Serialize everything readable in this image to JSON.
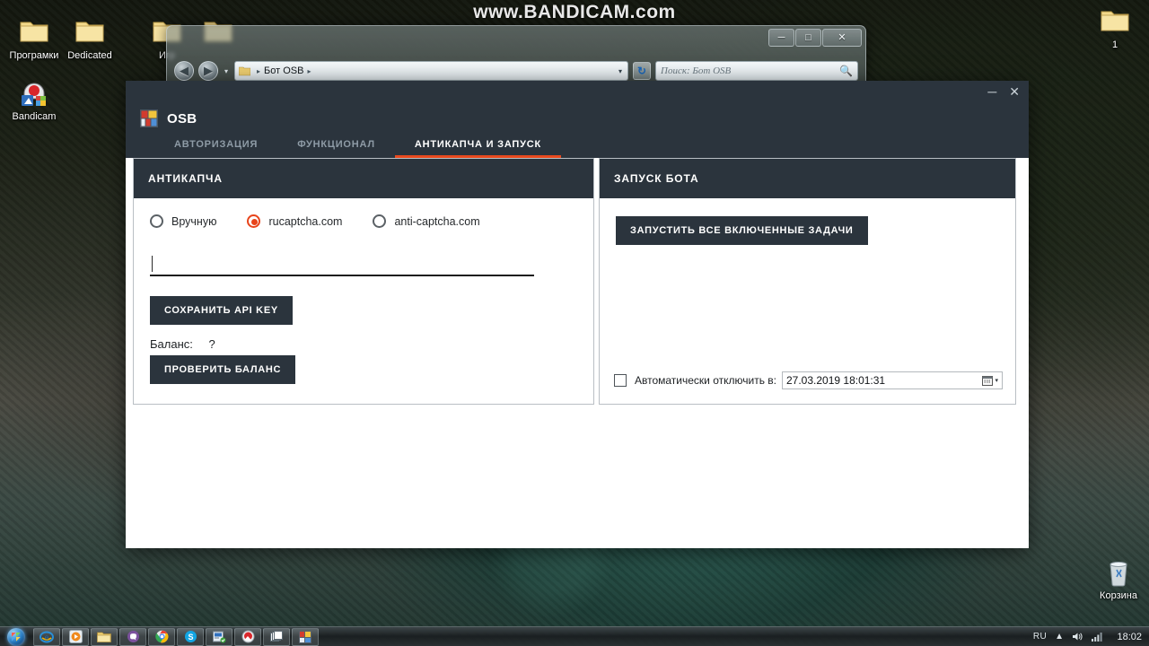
{
  "watermark": {
    "text": "www.BANDICAM.com"
  },
  "desktop": {
    "icons": [
      {
        "name": "folder-programki",
        "label": "Програмки",
        "icon": "folder-icon"
      },
      {
        "name": "folder-dedicated",
        "label": "Dedicated",
        "icon": "folder-icon"
      },
      {
        "name": "folder-igri",
        "label": "Игр",
        "icon": "folder-icon"
      },
      {
        "name": "folder-unnamed",
        "label": "",
        "icon": "folder-icon"
      },
      {
        "name": "folder-one",
        "label": "1",
        "icon": "folder-icon"
      },
      {
        "name": "shortcut-bandicam",
        "label": "Bandicam",
        "icon": "bandicam-icon"
      },
      {
        "name": "recycle-bin",
        "label": "Корзина",
        "icon": "recycle-bin-icon"
      }
    ]
  },
  "explorer": {
    "back_icon": "back-arrow-icon",
    "forward_icon": "forward-arrow-icon",
    "history_caret": "▾",
    "address": {
      "path": "Бот OSB",
      "sep": "▸",
      "caret": "▾"
    },
    "refresh_label": "↻",
    "search": {
      "placeholder": "Поиск: Бот OSB",
      "icon": "search-icon"
    },
    "window_buttons": {
      "minimize": "─",
      "maximize": "□",
      "close": "✕"
    }
  },
  "osb": {
    "title": "OSB",
    "logo_icon": "osb-logo-icon",
    "window_buttons": {
      "minimize": "─",
      "close": "✕"
    },
    "accent_color": "#e8491e",
    "header_color": "#2b343d",
    "tabs": [
      {
        "id": "tab-authorization",
        "label": "АВТОРИЗАЦИЯ",
        "active": false
      },
      {
        "id": "tab-functional",
        "label": "ФУНКЦИОНАЛ",
        "active": false
      },
      {
        "id": "tab-anticaptcha-launch",
        "label": "АНТИКАПЧА И ЗАПУСК",
        "active": true
      }
    ],
    "anticaptcha_panel": {
      "title": "АНТИКАПЧА",
      "radios": [
        {
          "id": "radio-manual",
          "label": "Вручную",
          "selected": false
        },
        {
          "id": "radio-rucaptcha",
          "label": "rucaptcha.com",
          "selected": true
        },
        {
          "id": "radio-anticaptcha",
          "label": "anti-captcha.com",
          "selected": false
        }
      ],
      "api_key_value": "",
      "save_api_key_label": "СОХРАНИТЬ API KEY",
      "balance_label": "Баланс:",
      "balance_value": "?",
      "check_balance_label": "ПРОВЕРИТЬ БАЛАНС"
    },
    "launch_panel": {
      "title": "ЗАПУСК БОТА",
      "run_all_label": "ЗАПУСТИТЬ ВСЕ ВКЛЮЧЕННЫЕ ЗАДАЧИ",
      "auto_off_checked": false,
      "auto_off_label": "Автоматически отключить в:",
      "datetime_value": "27.03.2019 18:01:31",
      "calendar_icon": "calendar-icon",
      "dropdown_caret": "▾"
    }
  },
  "taskbar": {
    "start_icon": "windows-start-icon",
    "items": [
      {
        "name": "taskbar-internet-explorer",
        "icon": "internet-explorer-icon"
      },
      {
        "name": "taskbar-media-player",
        "icon": "media-player-icon"
      },
      {
        "name": "taskbar-explorer",
        "icon": "folder-icon"
      },
      {
        "name": "taskbar-viber",
        "icon": "viber-icon"
      },
      {
        "name": "taskbar-chrome",
        "icon": "chrome-icon"
      },
      {
        "name": "taskbar-skype",
        "icon": "skype-icon"
      },
      {
        "name": "taskbar-app",
        "icon": "blue-app-icon"
      },
      {
        "name": "taskbar-bandicam",
        "icon": "bandicam-icon"
      },
      {
        "name": "taskbar-windows-group",
        "icon": "stacked-windows-icon"
      },
      {
        "name": "taskbar-osb",
        "icon": "osb-logo-icon"
      }
    ],
    "tray": {
      "language": "RU",
      "show_hidden_icon": "chevron-up-icon",
      "volume_icon": "volume-icon",
      "network_icon": "network-bars-icon",
      "clock": "18:02"
    }
  }
}
